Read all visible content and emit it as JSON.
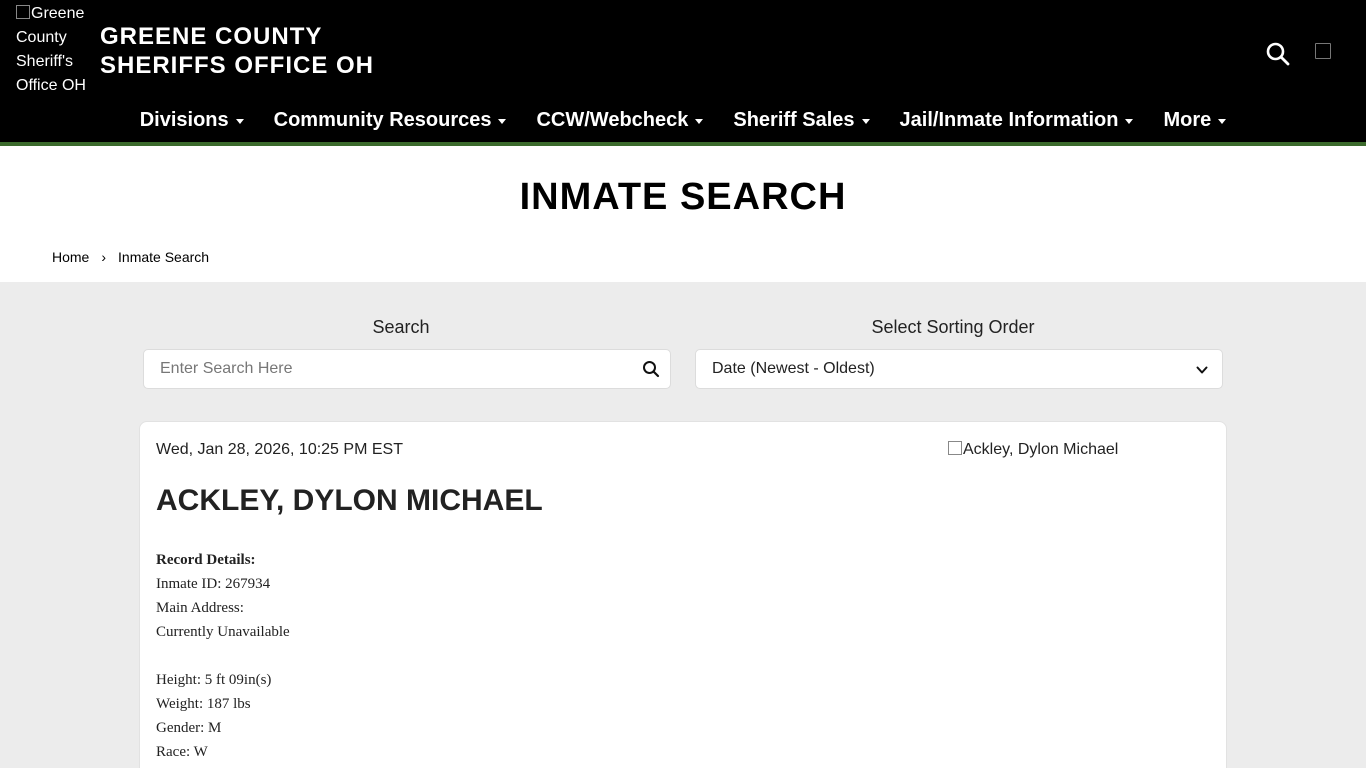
{
  "header": {
    "logo_alt": "Greene County Sheriff's Office OH",
    "site_title_line1": "GREENE COUNTY",
    "site_title_line2": "SHERIFFS OFFICE OH",
    "search_icon": "search-icon"
  },
  "nav": {
    "items": [
      {
        "label": "Divisions"
      },
      {
        "label": "Community Resources"
      },
      {
        "label": "CCW/Webcheck"
      },
      {
        "label": "Sheriff Sales"
      },
      {
        "label": "Jail/Inmate Information"
      },
      {
        "label": "More"
      }
    ]
  },
  "page": {
    "title": "INMATE SEARCH",
    "breadcrumb": {
      "home": "Home",
      "separator": "›",
      "current": "Inmate Search"
    }
  },
  "search": {
    "label": "Search",
    "placeholder": "Enter Search Here",
    "sort_label": "Select Sorting Order",
    "sort_value": "Date (Newest - Oldest)"
  },
  "record": {
    "datetime": "Wed, Jan 28, 2026, 10:25 PM EST",
    "photo_alt": "Ackley, Dylon Michael",
    "name": "ACKLEY, DYLON MICHAEL",
    "details_heading": "Record Details:",
    "inmate_id": "Inmate ID: 267934",
    "main_address_label": "Main Address:",
    "main_address_value": "Currently Unavailable",
    "height": "Height: 5 ft 09in(s)",
    "weight": "Weight: 187 lbs",
    "gender": "Gender: M",
    "race": "Race: W"
  },
  "colors": {
    "header_bg": "#000000",
    "accent_green": "#3b6a2c",
    "page_bg": "#ececec"
  }
}
